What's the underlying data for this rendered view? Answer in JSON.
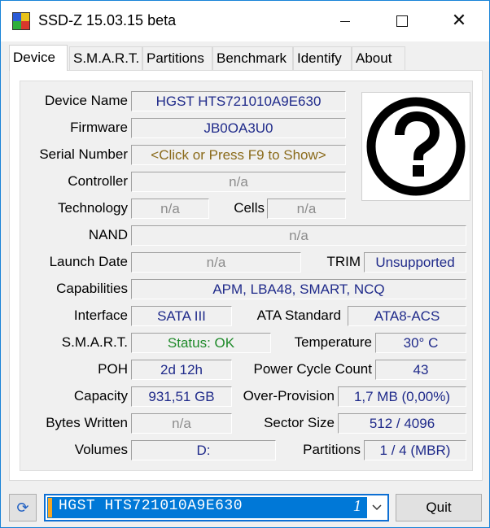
{
  "window": {
    "title": "SSD-Z 15.03.15 beta",
    "icons": {
      "app": "app-icon",
      "minimize": "minimize-icon",
      "maximize": "maximize-icon",
      "close": "close-icon"
    }
  },
  "tabs": [
    {
      "label": "Device",
      "active": true
    },
    {
      "label": "S.M.A.R.T.",
      "active": false
    },
    {
      "label": "Partitions",
      "active": false
    },
    {
      "label": "Benchmark",
      "active": false
    },
    {
      "label": "Identify",
      "active": false
    },
    {
      "label": "About",
      "active": false
    }
  ],
  "device": {
    "device_name": {
      "label": "Device Name",
      "value": "HGST HTS721010A9E630"
    },
    "firmware": {
      "label": "Firmware",
      "value": "JB0OA3U0"
    },
    "serial_number": {
      "label": "Serial Number",
      "value": "<Click or Press F9 to Show>"
    },
    "controller": {
      "label": "Controller",
      "value": "n/a"
    },
    "technology": {
      "label": "Technology",
      "value": "n/a"
    },
    "cells": {
      "label": "Cells",
      "value": "n/a"
    },
    "nand": {
      "label": "NAND",
      "value": "n/a"
    },
    "launch_date": {
      "label": "Launch Date",
      "value": "n/a"
    },
    "trim": {
      "label": "TRIM",
      "value": "Unsupported"
    },
    "capabilities": {
      "label": "Capabilities",
      "value": "APM, LBA48, SMART, NCQ"
    },
    "interface": {
      "label": "Interface",
      "value": "SATA III"
    },
    "ata_standard": {
      "label": "ATA Standard",
      "value": "ATA8-ACS"
    },
    "smart": {
      "label": "S.M.A.R.T.",
      "value": "Status: OK"
    },
    "temperature": {
      "label": "Temperature",
      "value": "30° C"
    },
    "poh": {
      "label": "POH",
      "value": "2d 12h"
    },
    "power_cycle_count": {
      "label": "Power Cycle Count",
      "value": "43"
    },
    "capacity": {
      "label": "Capacity",
      "value": "931,51 GB"
    },
    "over_provision": {
      "label": "Over-Provision",
      "value": "1,7 MB (0,00%)"
    },
    "bytes_written": {
      "label": "Bytes Written",
      "value": "n/a"
    },
    "sector_size": {
      "label": "Sector Size",
      "value": "512 / 4096"
    },
    "volumes": {
      "label": "Volumes",
      "value": "D:"
    },
    "partitions": {
      "label": "Partitions",
      "value": "1 / 4 (MBR)"
    },
    "image_icon": "question-mark-icon"
  },
  "colors": {
    "value_navy": "#1f2a8a",
    "value_gray": "#8c8c8c",
    "value_brown": "#8a6a1a",
    "value_green": "#1f8a2a",
    "selection_blue": "#0078d7",
    "selection_marker": "#f5a623"
  },
  "footer": {
    "refresh_icon": "refresh-icon",
    "drive_select": {
      "selected": "HGST HTS721010A9E630",
      "index": "1"
    },
    "quit_label": "Quit"
  }
}
